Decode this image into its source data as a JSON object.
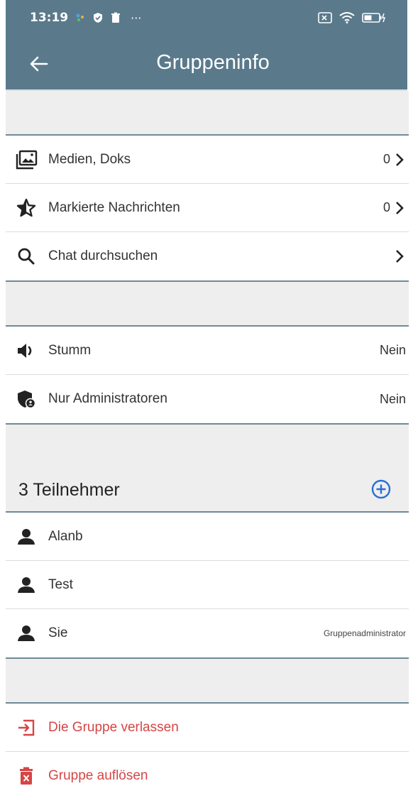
{
  "status": {
    "time": "13:19",
    "dots": "···"
  },
  "appbar": {
    "title": "Gruppeninfo"
  },
  "menu": [
    {
      "label": "Medien, Doks",
      "value": "0",
      "icon": "media-icon"
    },
    {
      "label": "Markierte Nachrichten",
      "value": "0",
      "icon": "star-icon"
    },
    {
      "label": "Chat durchsuchen",
      "value": "",
      "icon": "search-icon"
    }
  ],
  "settings": [
    {
      "label": "Stumm",
      "value": "Nein",
      "icon": "speaker-icon"
    },
    {
      "label": "Nur Administratoren",
      "value": "Nein",
      "icon": "admin-shield-icon"
    }
  ],
  "participants": {
    "heading": "3 Teilnehmer",
    "items": [
      {
        "name": "Alanb",
        "role": ""
      },
      {
        "name": "Test",
        "role": ""
      },
      {
        "name": "Sie",
        "role": "Gruppenadministrator"
      }
    ]
  },
  "actions": [
    {
      "label": "Die Gruppe verlassen",
      "icon": "leave-icon"
    },
    {
      "label": "Gruppe auflösen",
      "icon": "trash-icon"
    }
  ],
  "colors": {
    "appbar": "#5a7a8c",
    "danger": "#d64545",
    "accent": "#2a6fd6"
  }
}
